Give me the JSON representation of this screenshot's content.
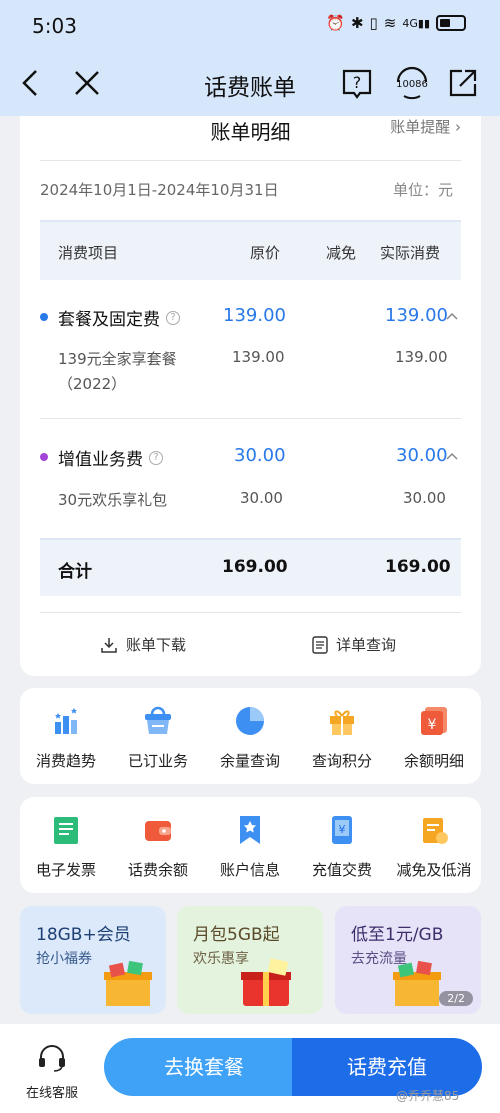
{
  "status_bar": {
    "time": "5:03",
    "network": "4G"
  },
  "header": {
    "title": "话费账单",
    "service_number": "10086"
  },
  "bill": {
    "title": "账单明细",
    "remind_label": "账单提醒",
    "date_range": "2024年10月1日-2024年10月31日",
    "unit": "单位：元",
    "columns": [
      "消费项目",
      "原价",
      "减免",
      "实际消费"
    ],
    "groups": [
      {
        "name": "套餐及固定费",
        "original": "139.00",
        "actual": "139.00",
        "dot_color": "#2979e8",
        "item_line1": "139元全家享套餐",
        "item_line2": "（2022）",
        "item_original": "139.00",
        "item_actual": "139.00"
      },
      {
        "name": "增值业务费",
        "original": "30.00",
        "actual": "30.00",
        "dot_color": "#a145d6",
        "item_line1": "30元欢乐享礼包",
        "item_line2": "",
        "item_original": "30.00",
        "item_actual": "30.00"
      }
    ],
    "total": {
      "label": "合计",
      "original": "169.00",
      "actual": "169.00"
    },
    "download_label": "账单下载",
    "detail_label": "详单查询"
  },
  "services_row1": [
    "消费趋势",
    "已订业务",
    "余量查询",
    "查询积分",
    "余额明细"
  ],
  "services_row2": [
    "电子发票",
    "话费余额",
    "账户信息",
    "充值交费",
    "减免及低消"
  ],
  "promos": [
    {
      "title": "18GB+会员",
      "subtitle": "抢小福券",
      "bg": "#dbe9fb"
    },
    {
      "title": "月包5GB起",
      "subtitle": "欢乐惠享",
      "bg": "#e4f3de"
    },
    {
      "title": "低至1元/GB",
      "subtitle": "去充流量",
      "bg": "#e6e2f7"
    }
  ],
  "promo_pager": "2/2",
  "bottom_bar": {
    "service_label": "在线客服",
    "change_plan": "去换套餐",
    "recharge": "话费充值"
  },
  "watermark": "@乔乔慧85"
}
